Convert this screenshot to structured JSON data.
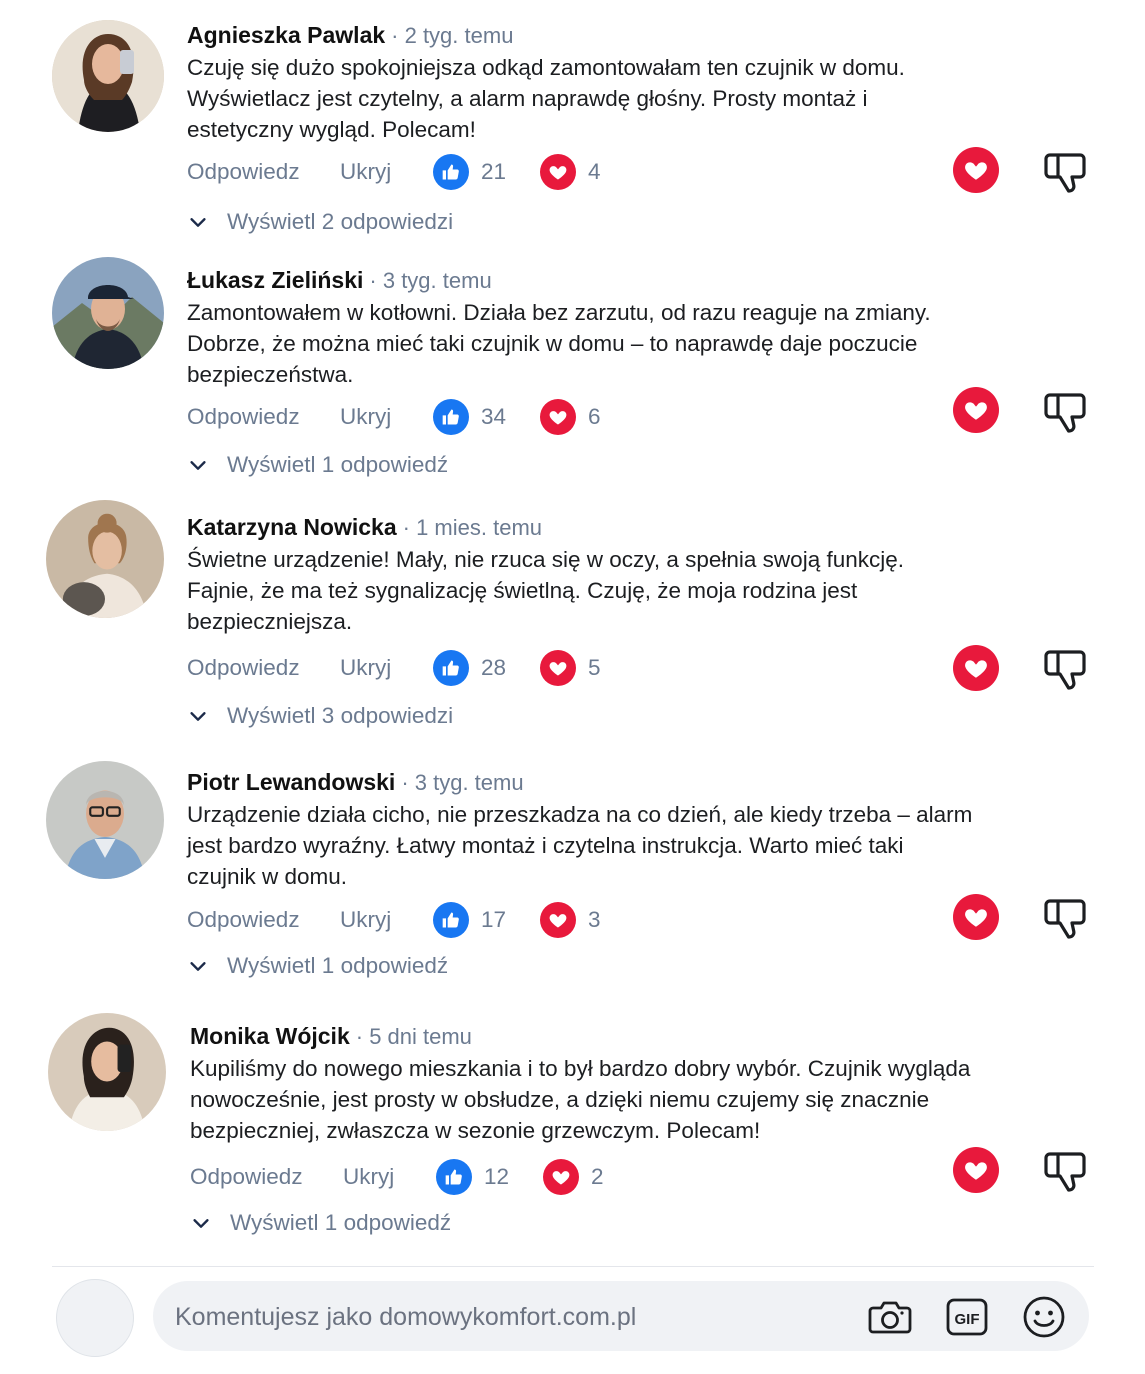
{
  "labels": {
    "reply": "Odpowiedz",
    "hide": "Ukryj"
  },
  "comments": [
    {
      "author": "Agnieszka Pawlak",
      "time": "· 2 tyg. temu",
      "text": "Czuję się dużo spokojniejsza odkąd zamontowałam ten czujnik w domu. Wyświetlacz jest czytelny, a alarm naprawdę głośny. Prosty montaż i estetyczny wygląd. Polecam!",
      "likes": "21",
      "hearts": "4",
      "replies": "Wyświetl 2 odpowiedzi"
    },
    {
      "author": "Łukasz Zieliński",
      "time": "· 3 tyg. temu",
      "text": "Zamontowałem w kotłowni. Działa bez zarzutu, od razu reaguje na zmiany. Dobrze, że można mieć taki czujnik w domu – to naprawdę daje poczucie bezpieczeństwa.",
      "likes": "34",
      "hearts": "6",
      "replies": "Wyświetl 1 odpowiedź"
    },
    {
      "author": "Katarzyna Nowicka",
      "time": "· 1 mies. temu",
      "text": "Świetne urządzenie! Mały, nie rzuca się w oczy, a spełnia swoją funkcję. Fajnie, że ma też sygnalizację świetlną. Czuję, że moja rodzina jest bezpieczniejsza.",
      "likes": "28",
      "hearts": "5",
      "replies": "Wyświetl 3 odpowiedzi"
    },
    {
      "author": "Piotr Lewandowski",
      "time": "· 3 tyg. temu",
      "text": "Urządzenie działa cicho, nie przeszkadza na co dzień, ale kiedy trzeba – alarm jest bardzo wyraźny. Łatwy montaż i czytelna instrukcja. Warto mieć taki czujnik w domu.",
      "likes": "17",
      "hearts": "3",
      "replies": "Wyświetl 1 odpowiedź"
    },
    {
      "author": "Monika Wójcik",
      "time": "· 5 dni temu",
      "text": "Kupiliśmy do nowego mieszkania i to był bardzo dobry wybór. Czujnik wygląda nowocześnie, jest prosty w obsłudze, a dzięki niemu czujemy się znacznie bezpieczniej, zwłaszcza w sezonie grzewczym. Polecam!",
      "likes": "12",
      "hearts": "2",
      "replies": "Wyświetl 1 odpowiedź"
    }
  ],
  "composer": {
    "placeholder": "Komentujesz jako domowykomfort.com.pl"
  },
  "icons": {
    "like": "thumbs-up-icon",
    "heart": "heart-icon",
    "dislike": "thumbs-down-icon",
    "camera": "camera-icon",
    "gif": "gif-icon",
    "emoji": "emoji-icon"
  },
  "colors": {
    "like_blue": "#1877f2",
    "heart_red": "#e8193c",
    "muted_text": "#6b7a90"
  }
}
